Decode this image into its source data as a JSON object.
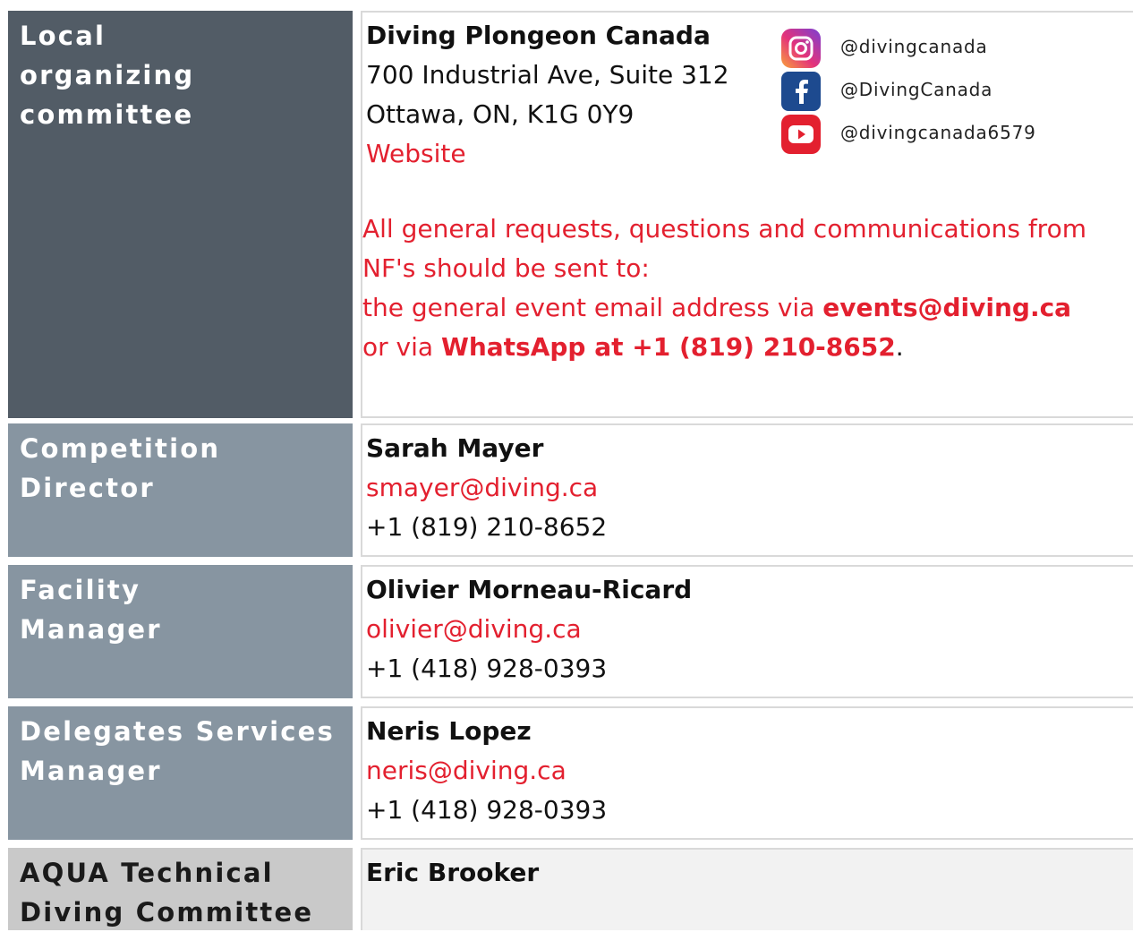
{
  "colors": {
    "label_dark": "#525c66",
    "label_mid": "#8795a1",
    "label_light": "#c9c9c9",
    "accent_red": "#e3202f"
  },
  "rows": [
    {
      "label": [
        "Local",
        "organizing",
        "committee"
      ],
      "org": "Diving Plongeon Canada",
      "address": [
        "700 Industrial Ave, Suite 312",
        "Ottawa, ON, K1G 0Y9"
      ],
      "website": "Website",
      "social": [
        {
          "icon": "instagram-icon",
          "handle": "@divingcanada"
        },
        {
          "icon": "facebook-icon",
          "handle": "@DivingCanada"
        },
        {
          "icon": "youtube-icon",
          "handle": "@divingcanada6579"
        }
      ],
      "notice": {
        "line1": "All general requests, questions and communications from",
        "line2": "NF's should be sent to:",
        "line3_prefix": "the general event email address via ",
        "email": "events@diving.ca",
        "line4_prefix": "or via ",
        "whatsapp": "WhatsApp at +1 (819) 210-8652",
        "line4_suffix": "."
      }
    },
    {
      "label": [
        "Competition",
        "Director"
      ],
      "name": "Sarah Mayer",
      "email": "smayer@diving.ca",
      "phone": "+1 (819) 210-8652"
    },
    {
      "label": [
        "Facility",
        "Manager"
      ],
      "name": "Olivier Morneau-Ricard",
      "email": "olivier@diving.ca",
      "phone": "+1 (418) 928-0393"
    },
    {
      "label": [
        "Delegates Services",
        "Manager"
      ],
      "name": "Neris Lopez",
      "email": "neris@diving.ca",
      "phone": "+1 (418) 928-0393"
    },
    {
      "label": [
        "AQUA Technical",
        "Diving Committee"
      ],
      "name": "Eric Brooker"
    }
  ]
}
